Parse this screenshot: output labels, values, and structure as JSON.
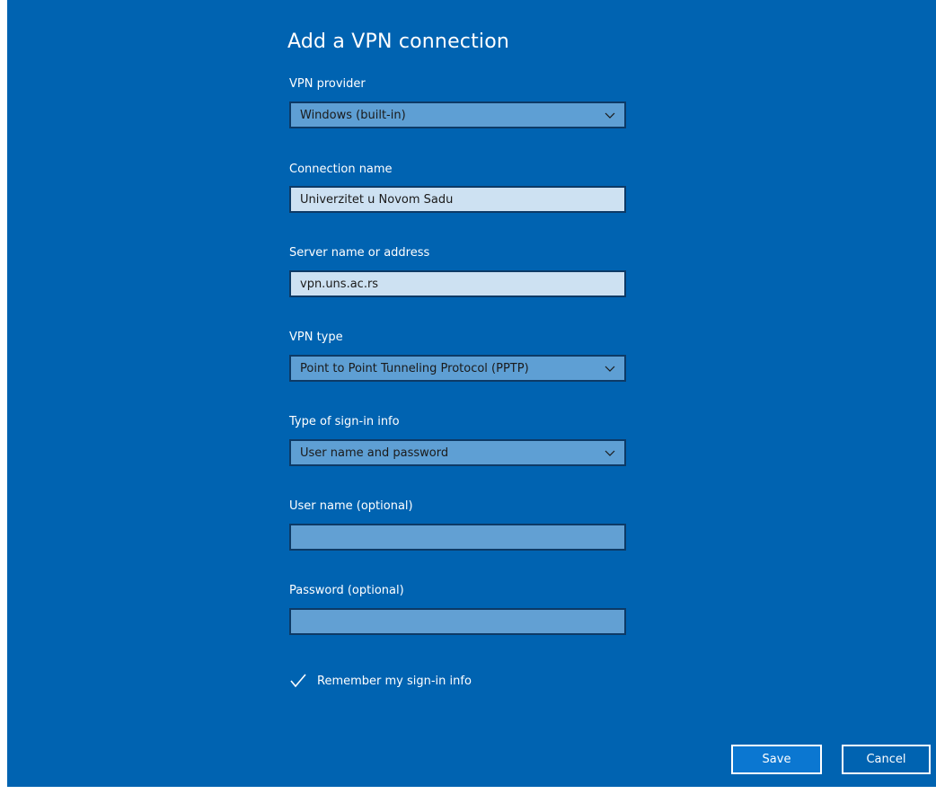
{
  "dialog": {
    "title": "Add a VPN connection"
  },
  "vpn_provider": {
    "label": "VPN provider",
    "value": "Windows (built-in)",
    "icon": "chevron-down-icon"
  },
  "connection_name": {
    "label": "Connection name",
    "value": "Univerzitet u Novom Sadu"
  },
  "server": {
    "label": "Server name or address",
    "value": "vpn.uns.ac.rs"
  },
  "vpn_type": {
    "label": "VPN type",
    "value": "Point to Point Tunneling Protocol (PPTP)",
    "icon": "chevron-down-icon"
  },
  "sign_in_type": {
    "label": "Type of sign-in info",
    "value": "User name and password",
    "icon": "chevron-down-icon"
  },
  "username": {
    "label": "User name (optional)",
    "value": ""
  },
  "password": {
    "label": "Password (optional)",
    "value": ""
  },
  "remember": {
    "label": "Remember my sign-in info",
    "checked": true,
    "icon": "checkmark-icon"
  },
  "buttons": {
    "save": "Save",
    "cancel": "Cancel"
  },
  "colors": {
    "background": "#0063b1",
    "dropdown": "#5e9fd4",
    "input_filled": "#cde1f2",
    "input_empty": "#62a0d3",
    "border": "#0d3a66"
  }
}
